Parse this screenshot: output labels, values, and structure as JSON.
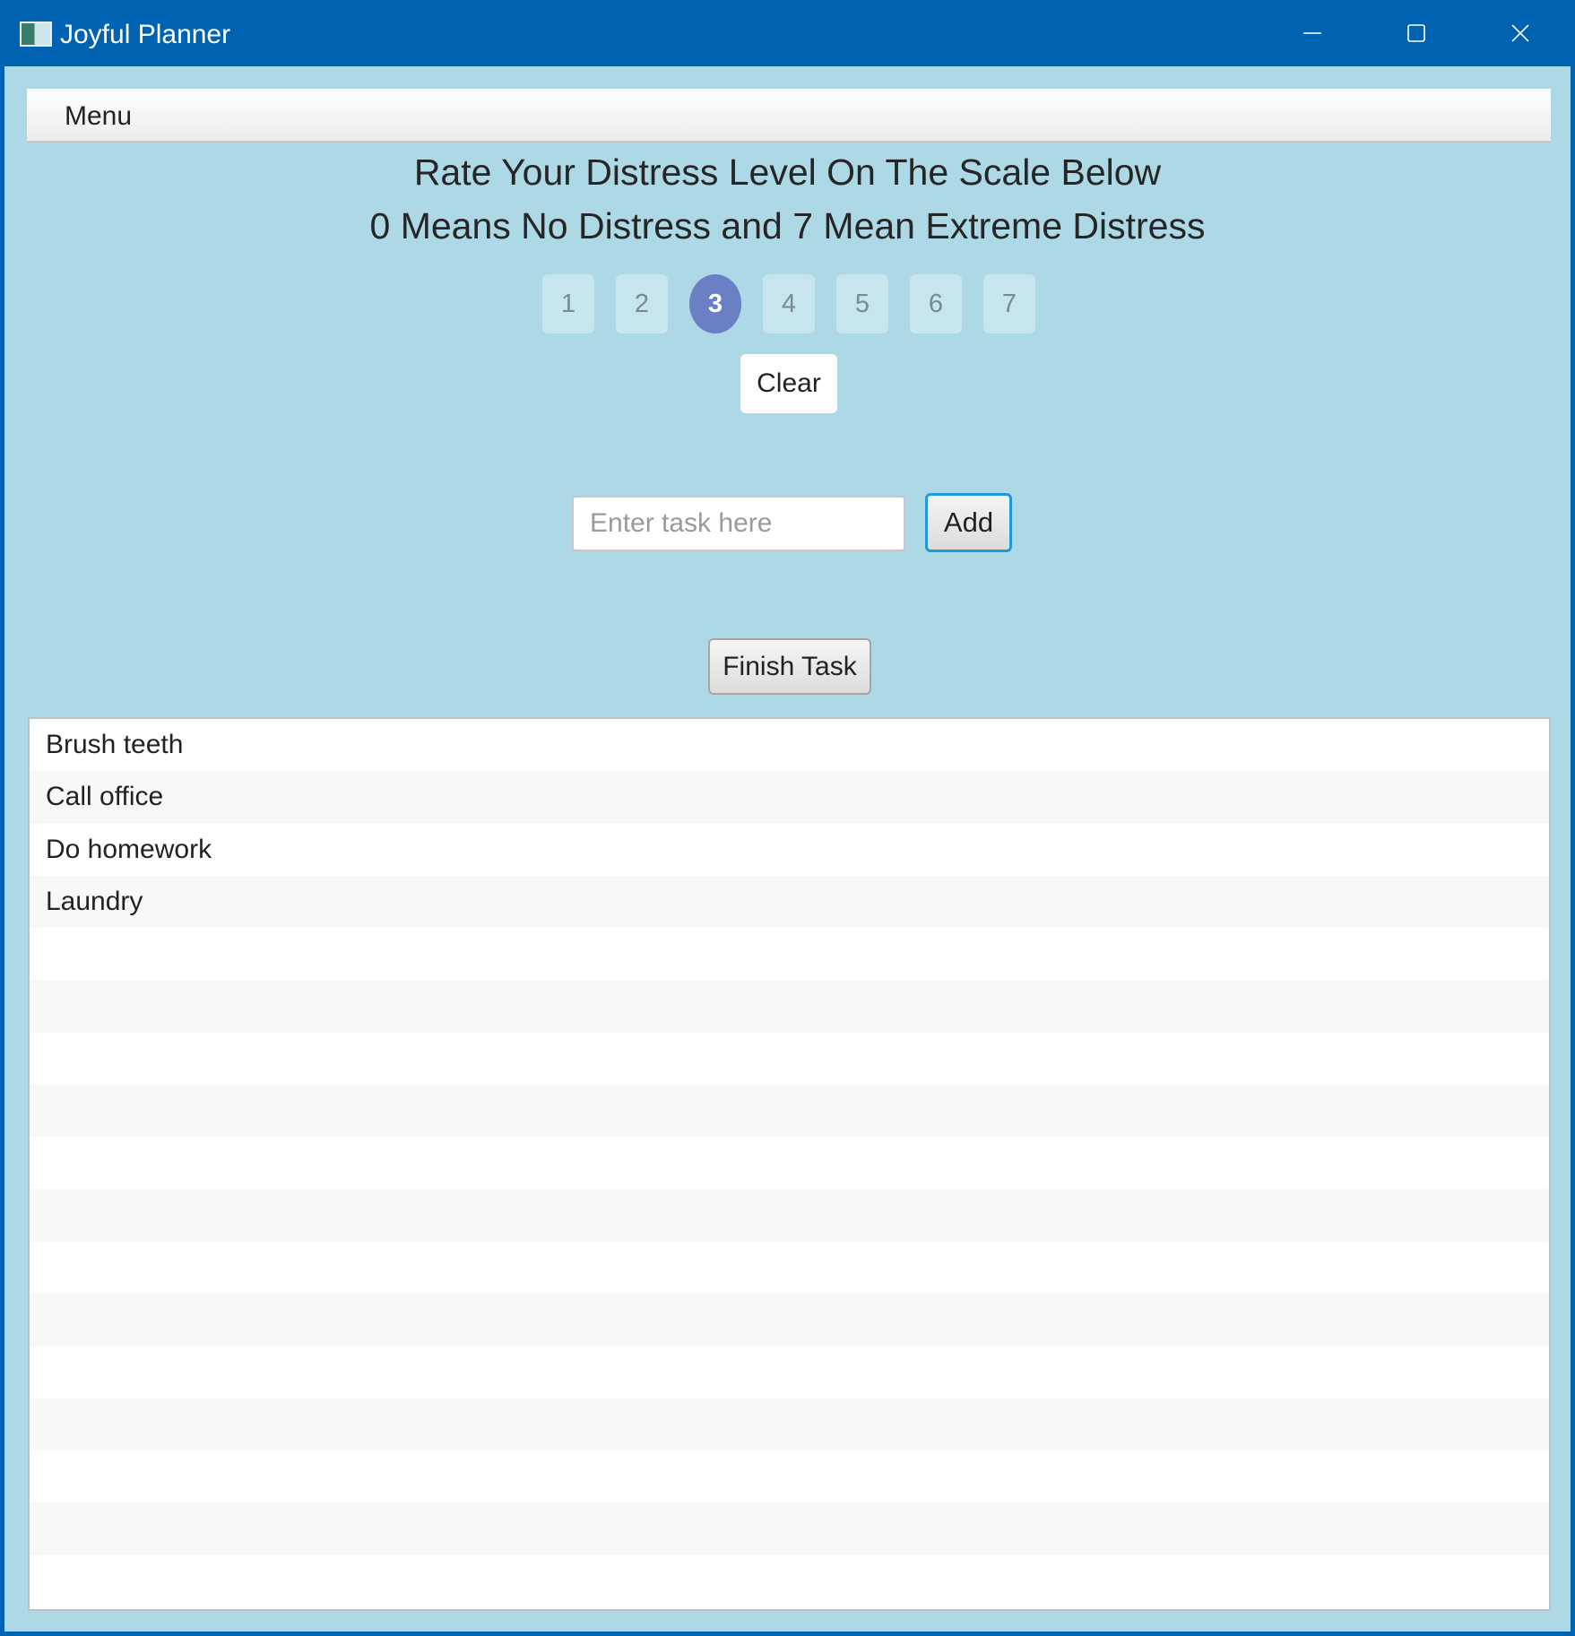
{
  "window": {
    "title": "Joyful Planner",
    "icon": "app-icon",
    "controls": [
      "minimize-icon",
      "maximize-icon",
      "close-icon"
    ]
  },
  "menubar": {
    "items": [
      {
        "label": "Menu"
      }
    ]
  },
  "prompt": {
    "line1": "Rate Your Distress Level On The Scale Below",
    "line2": "0 Means No Distress and 7 Mean Extreme Distress"
  },
  "rating": {
    "options": [
      "1",
      "2",
      "3",
      "4",
      "5",
      "6",
      "7"
    ],
    "selected": "3"
  },
  "clear_label": "Clear",
  "task_entry": {
    "placeholder": "Enter task here",
    "value": "",
    "add_label": "Add"
  },
  "finish_label": "Finish Task",
  "tasks": [
    {
      "label": "Brush teeth"
    },
    {
      "label": "Call office"
    },
    {
      "label": "Do homework"
    },
    {
      "label": "Laundry"
    }
  ],
  "colors": {
    "titlebar": "#0063b1",
    "background": "#add8e6",
    "rating_selected": "#6a7fc4",
    "add_focus": "#1e9ad8"
  }
}
